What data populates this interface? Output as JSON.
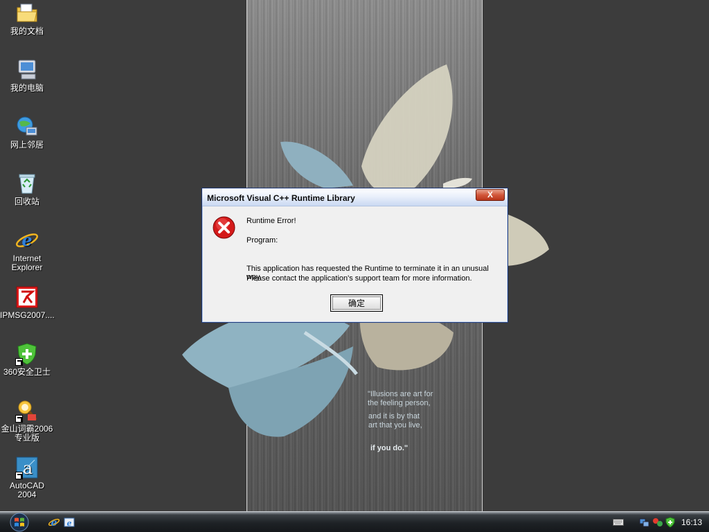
{
  "desktop": {
    "icons": [
      {
        "label": "我的文档",
        "icon": "my-documents-icon"
      },
      {
        "label": "我的电脑",
        "icon": "my-computer-icon"
      },
      {
        "label": "网上邻居",
        "icon": "network-places-icon"
      },
      {
        "label": "回收站",
        "icon": "recycle-bin-icon"
      },
      {
        "label": "Internet Explorer",
        "icon": "internet-explorer-icon"
      },
      {
        "label": "IPMSG2007....",
        "icon": "ipmsg-icon"
      },
      {
        "label": "360安全卫士",
        "icon": "360-security-icon"
      },
      {
        "label": "金山词霸2006 专业版",
        "icon": "kingsoft-powerword-icon"
      },
      {
        "label": "AutoCAD 2004",
        "icon": "autocad-icon"
      }
    ],
    "wallpaper_quote": {
      "line1": "\"Illusions are art for",
      "line2": "the feeling person,",
      "line3": "and it is by that",
      "line4": "art that you live,",
      "line5": "if you do.\""
    }
  },
  "dialog": {
    "title": "Microsoft Visual C++ Runtime Library",
    "close_label": "X",
    "icon": "error-icon",
    "heading": "Runtime Error!",
    "program": "Program:",
    "message_line1": "This application has requested the Runtime to terminate it in an unusual way.",
    "message_line2": "Please contact the application's support team for more information.",
    "ok_label": "确定"
  },
  "taskbar": {
    "clock": "16:13",
    "colors": {
      "dialog_border": "#1f3a7a",
      "close_red": "#d2573a",
      "error_red": "#cc1010"
    }
  }
}
